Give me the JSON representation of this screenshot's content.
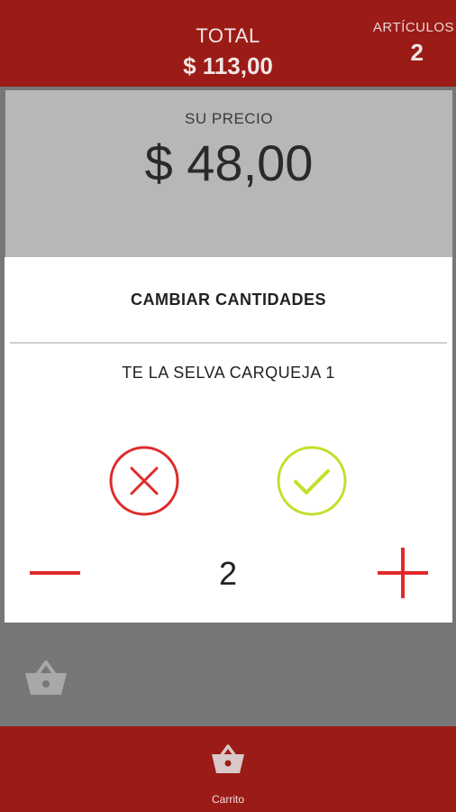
{
  "header": {
    "total_label": "TOTAL",
    "total_value": "$ 113,00",
    "articles_label": "ARTÍCULOS",
    "articles_count": "2"
  },
  "price_panel": {
    "label": "SU PRECIO",
    "value": "$ 48,00"
  },
  "dialog": {
    "title": "CAMBIAR CANTIDADES",
    "product_name": "TE LA SELVA CARQUEJA 1",
    "quantity": "2",
    "cancel_icon": "close-icon",
    "confirm_icon": "check-icon",
    "minus_icon": "minus-icon",
    "plus_icon": "plus-icon"
  },
  "bottom_nav": {
    "items": [
      {
        "label": "Carrito",
        "icon": "basket-icon"
      }
    ]
  },
  "colors": {
    "brand_red": "#9b1b16",
    "cancel_red": "#e02a2a",
    "confirm_green": "#c6dd2a",
    "overlay_gray": "#777777",
    "price_panel_gray": "#b7b7b7"
  }
}
